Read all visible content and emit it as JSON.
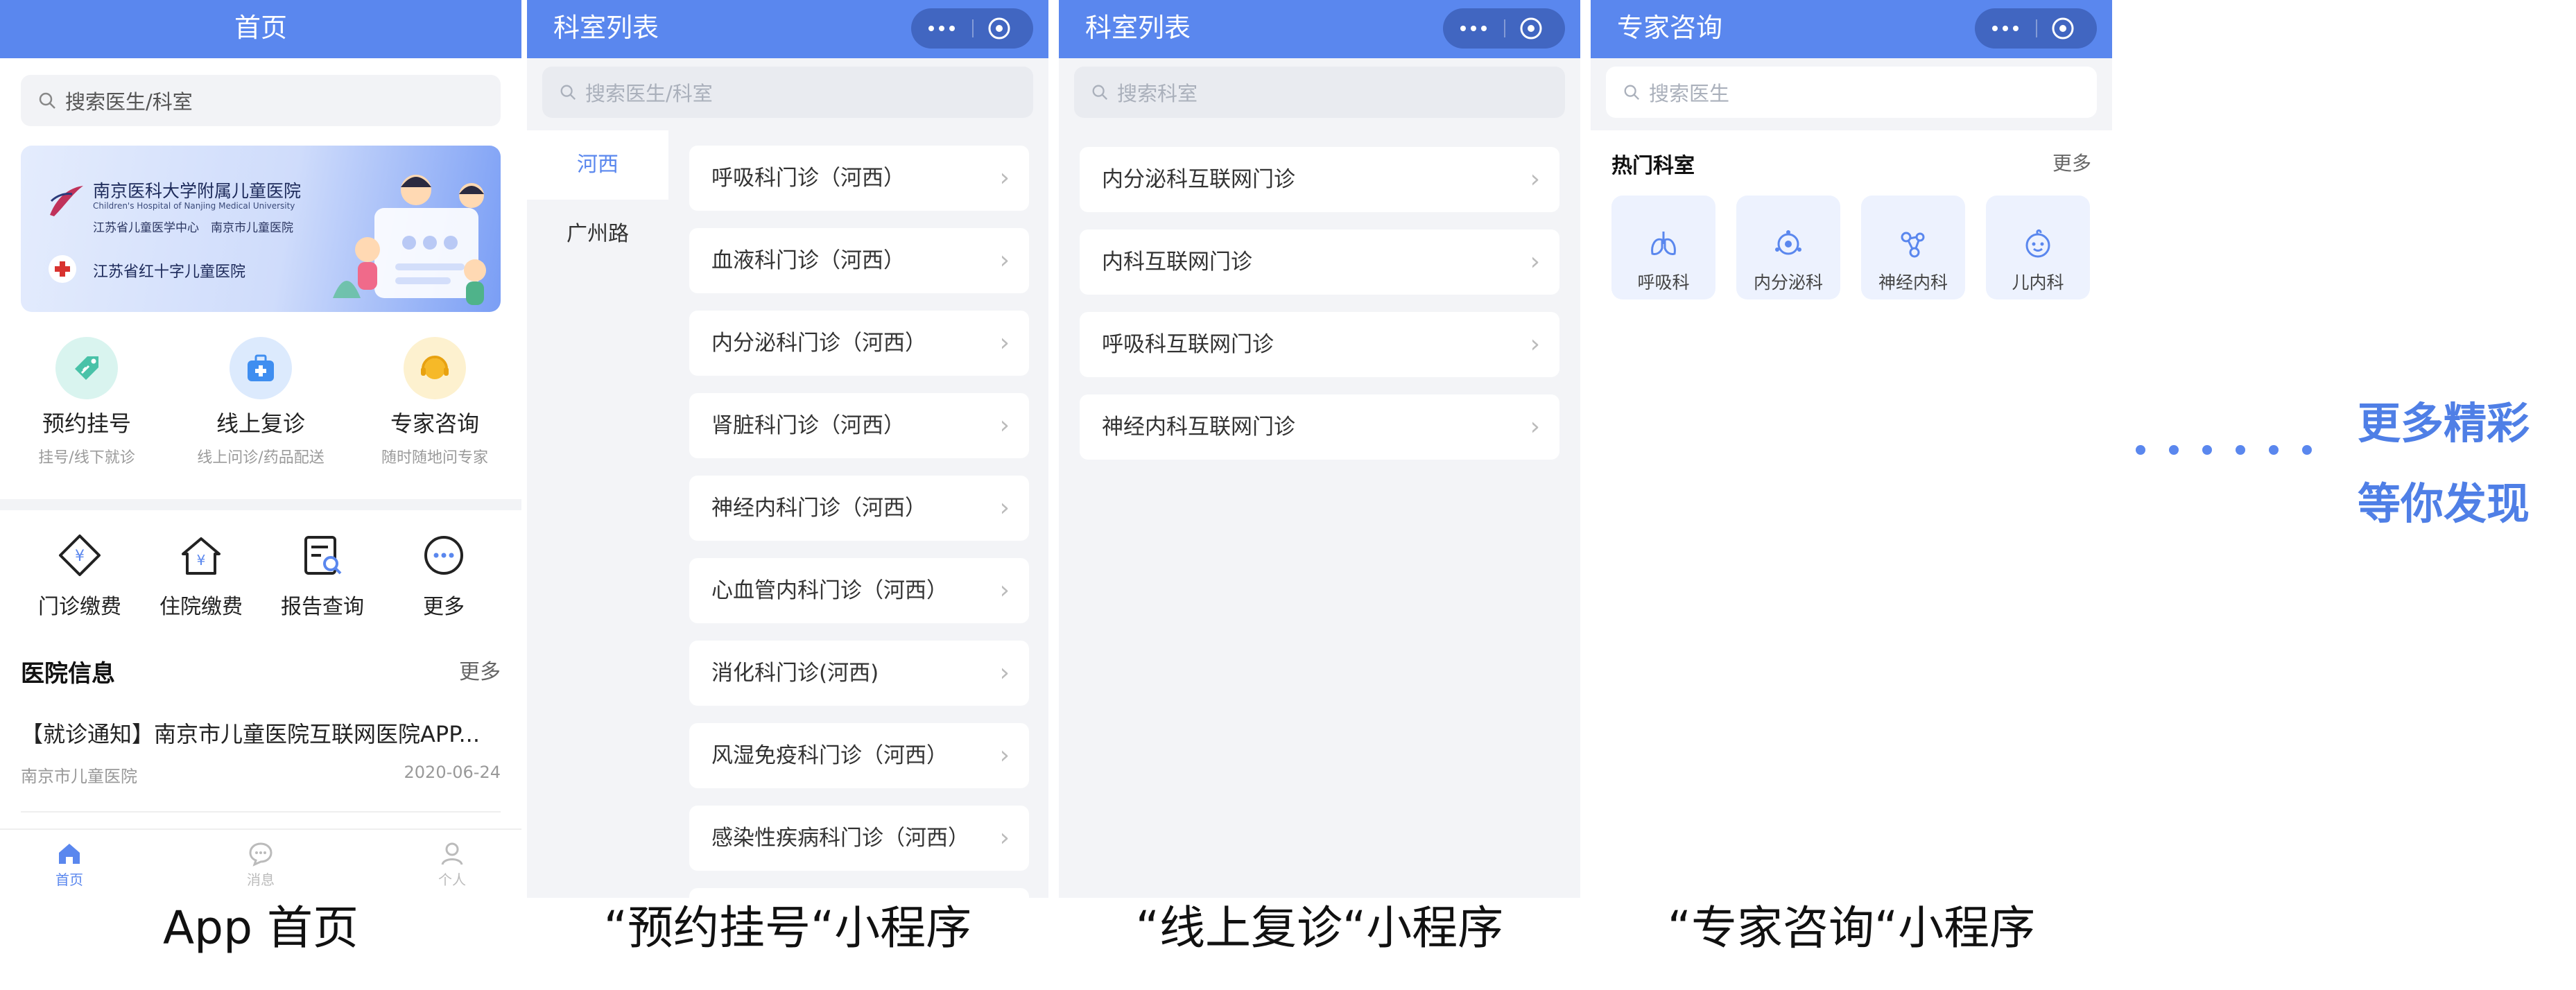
{
  "colors": {
    "primary": "#5a87ee",
    "background": "#f3f4f7",
    "text": "#222222",
    "muted": "#999999"
  },
  "screen1": {
    "title": "首页",
    "search_placeholder": "搜索医生/科室",
    "banner": {
      "hospital_cn": "南京医科大学附属儿童医院",
      "hospital_en": "Children's Hospital of Nanjing Medical University",
      "sub": "江苏省儿童医学中心　南京市儿童医院",
      "red_cross": "江苏省红十字儿童医院"
    },
    "services": [
      {
        "title": "预约挂号",
        "sub": "挂号/线下就诊",
        "icon": "tag-icon"
      },
      {
        "title": "线上复诊",
        "sub": "线上问诊/药品配送",
        "icon": "medical-kit-icon"
      },
      {
        "title": "专家咨询",
        "sub": "随时随地问专家",
        "icon": "headset-icon"
      }
    ],
    "quick": [
      {
        "label": "门诊缴费",
        "icon": "yuan-diamond-icon"
      },
      {
        "label": "住院缴费",
        "icon": "yuan-house-icon"
      },
      {
        "label": "报告查询",
        "icon": "report-search-icon"
      },
      {
        "label": "更多",
        "icon": "more-icon"
      }
    ],
    "info_title": "医院信息",
    "info_more": "更多",
    "news": {
      "title": "【就诊通知】南京市儿童医院互联网医院APP...",
      "source": "南京市儿童医院",
      "date": "2020-06-24"
    },
    "tabs": [
      {
        "label": "首页",
        "icon": "home-icon"
      },
      {
        "label": "消息",
        "icon": "message-icon"
      },
      {
        "label": "个人",
        "icon": "person-icon"
      }
    ]
  },
  "screen2": {
    "title": "科室列表",
    "search_placeholder": "搜索医生/科室",
    "sidebar": [
      "河西",
      "广州路"
    ],
    "departments": [
      "呼吸科门诊（河西）",
      "血液科门诊（河西）",
      "内分泌科门诊（河西）",
      "肾脏科门诊（河西）",
      "神经内科门诊（河西）",
      "心血管内科门诊（河西）",
      "消化科门诊(河西)",
      "风湿免疫科门诊（河西）",
      "感染性疾病科门诊（河西）"
    ]
  },
  "screen3": {
    "title": "科室列表",
    "search_placeholder": "搜索科室",
    "departments": [
      "内分泌科互联网门诊",
      "内科互联网门诊",
      "呼吸科互联网门诊",
      "神经内科互联网门诊"
    ]
  },
  "screen4": {
    "title": "专家咨询",
    "search_placeholder": "搜索医生",
    "hot_title": "热门科室",
    "hot_more": "更多",
    "departments": [
      {
        "label": "呼吸科",
        "icon": "lungs-icon"
      },
      {
        "label": "内分泌科",
        "icon": "gland-icon"
      },
      {
        "label": "神经内科",
        "icon": "neuron-icon"
      },
      {
        "label": "儿内科",
        "icon": "child-face-icon"
      }
    ]
  },
  "captions": [
    "App 首页",
    "“预约挂号“小程序",
    "“线上复诊“小程序",
    "“专家咨询“小程序"
  ],
  "more": {
    "line1": "更多精彩",
    "line2": "等你发现"
  }
}
